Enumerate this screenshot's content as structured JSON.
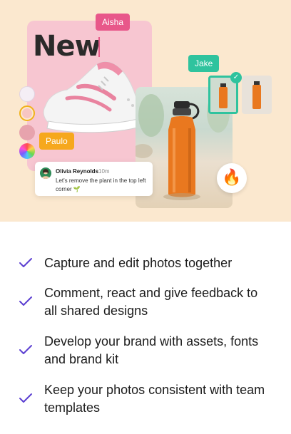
{
  "hero": {
    "headline": "New",
    "collaborators": {
      "aisha": "Aisha",
      "jake": "Jake",
      "paulo": "Paulo"
    },
    "comment": {
      "author": "Olivia Reynolds",
      "time": "10m",
      "text": "Let's remove the plant in the top left corner 🌱"
    },
    "reaction": "🔥",
    "swatch_colors": [
      "#f4eef5",
      "#f7c6c2",
      "#e7a3ad",
      "rainbow"
    ],
    "accent_colors": {
      "aisha_tag": "#e8578a",
      "jake_tag": "#2fc39e",
      "paulo_tag": "#f6a81d",
      "check": "#5b3fd1"
    }
  },
  "features": [
    {
      "label": "Capture and edit photos together"
    },
    {
      "label": "Comment, react and give feedback to all shared designs"
    },
    {
      "label": "Develop your brand with assets, fonts and brand kit"
    },
    {
      "label": "Keep your photos consistent with team templates"
    }
  ]
}
